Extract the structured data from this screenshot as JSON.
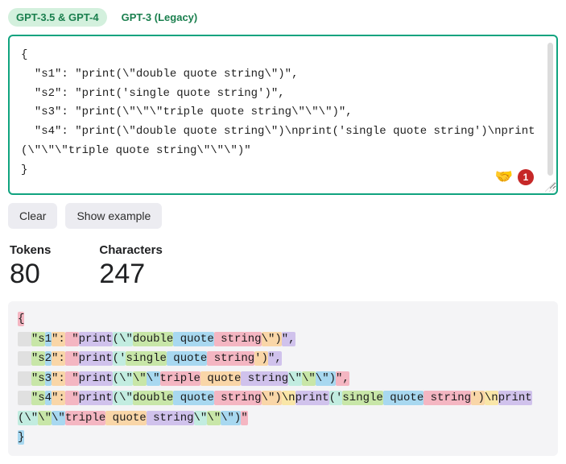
{
  "tabs": [
    {
      "label": "GPT-3.5 & GPT-4",
      "active": true
    },
    {
      "label": "GPT-3 (Legacy)",
      "active": false
    }
  ],
  "input_text": "{\n  \"s1\": \"print(\\\"double quote string\\\")\",\n  \"s2\": \"print('single quote string')\",\n  \"s3\": \"print(\\\"\\\"\\\"triple quote string\\\"\\\"\\\")\",\n  \"s4\": \"print(\\\"double quote string\\\")\\nprint('single quote string')\\nprint(\\\"\\\"\\\"triple quote string\\\"\\\"\\\")\"\n}",
  "reaction_emoji": "🤝",
  "reaction_count": "1",
  "buttons": {
    "clear": "Clear",
    "example": "Show example"
  },
  "stats": {
    "tokens_label": "Tokens",
    "tokens_value": "80",
    "chars_label": "Characters",
    "chars_value": "247"
  },
  "token_colors": [
    "#c8e6a8",
    "#f9d6a8",
    "#f4b6c2",
    "#a8d8f0",
    "#d0c2ec",
    "#c2ece0",
    "#f9e6a8",
    "#e0e0e0"
  ],
  "tokenized": [
    [
      {
        "t": "{",
        "c": 2
      }
    ],
    [
      {
        "t": "  ",
        "c": 7
      },
      {
        "t": "\"s",
        "c": 0
      },
      {
        "t": "1",
        "c": 3
      },
      {
        "t": "\":",
        "c": 1
      },
      {
        "t": " \"",
        "c": 2
      },
      {
        "t": "print",
        "c": 4
      },
      {
        "t": "(\\\"",
        "c": 5
      },
      {
        "t": "double",
        "c": 0
      },
      {
        "t": " quote",
        "c": 3
      },
      {
        "t": " string",
        "c": 2
      },
      {
        "t": "\\\")",
        "c": 1
      },
      {
        "t": "\",",
        "c": 4
      }
    ],
    [
      {
        "t": "  ",
        "c": 7
      },
      {
        "t": "\"s",
        "c": 0
      },
      {
        "t": "2",
        "c": 3
      },
      {
        "t": "\":",
        "c": 1
      },
      {
        "t": " \"",
        "c": 2
      },
      {
        "t": "print",
        "c": 4
      },
      {
        "t": "('",
        "c": 5
      },
      {
        "t": "single",
        "c": 0
      },
      {
        "t": " quote",
        "c": 3
      },
      {
        "t": " string",
        "c": 2
      },
      {
        "t": "')",
        "c": 1
      },
      {
        "t": "\",",
        "c": 4
      }
    ],
    [
      {
        "t": "  ",
        "c": 7
      },
      {
        "t": "\"s",
        "c": 0
      },
      {
        "t": "3",
        "c": 3
      },
      {
        "t": "\":",
        "c": 1
      },
      {
        "t": " \"",
        "c": 2
      },
      {
        "t": "print",
        "c": 4
      },
      {
        "t": "(\\\"",
        "c": 5
      },
      {
        "t": "\\\"",
        "c": 0
      },
      {
        "t": "\\\"",
        "c": 3
      },
      {
        "t": "triple",
        "c": 2
      },
      {
        "t": " quote",
        "c": 1
      },
      {
        "t": " string",
        "c": 4
      },
      {
        "t": "\\\"",
        "c": 5
      },
      {
        "t": "\\\"",
        "c": 0
      },
      {
        "t": "\\\")",
        "c": 3
      },
      {
        "t": "\",",
        "c": 2
      }
    ],
    [
      {
        "t": "  ",
        "c": 7
      },
      {
        "t": "\"s",
        "c": 0
      },
      {
        "t": "4",
        "c": 3
      },
      {
        "t": "\":",
        "c": 1
      },
      {
        "t": " \"",
        "c": 2
      },
      {
        "t": "print",
        "c": 4
      },
      {
        "t": "(\\\"",
        "c": 5
      },
      {
        "t": "double",
        "c": 0
      },
      {
        "t": " quote",
        "c": 3
      },
      {
        "t": " string",
        "c": 2
      },
      {
        "t": "\\\")",
        "c": 1
      },
      {
        "t": "\\n",
        "c": 6
      },
      {
        "t": "print",
        "c": 4
      },
      {
        "t": "('",
        "c": 5
      },
      {
        "t": "single",
        "c": 0
      },
      {
        "t": " quote",
        "c": 3
      },
      {
        "t": " string",
        "c": 2
      },
      {
        "t": "')",
        "c": 1
      },
      {
        "t": "\\n",
        "c": 6
      },
      {
        "t": "print",
        "c": 4
      },
      {
        "t": "(\\\"",
        "c": 5
      },
      {
        "t": "\\\"",
        "c": 0
      },
      {
        "t": "\\\"",
        "c": 3
      },
      {
        "t": "triple",
        "c": 2
      },
      {
        "t": " quote",
        "c": 1
      },
      {
        "t": " string",
        "c": 4
      },
      {
        "t": "\\\"",
        "c": 5
      },
      {
        "t": "\\\"",
        "c": 0
      },
      {
        "t": "\\\")",
        "c": 3
      },
      {
        "t": "\"",
        "c": 2
      }
    ],
    [
      {
        "t": "}",
        "c": 3
      }
    ]
  ]
}
